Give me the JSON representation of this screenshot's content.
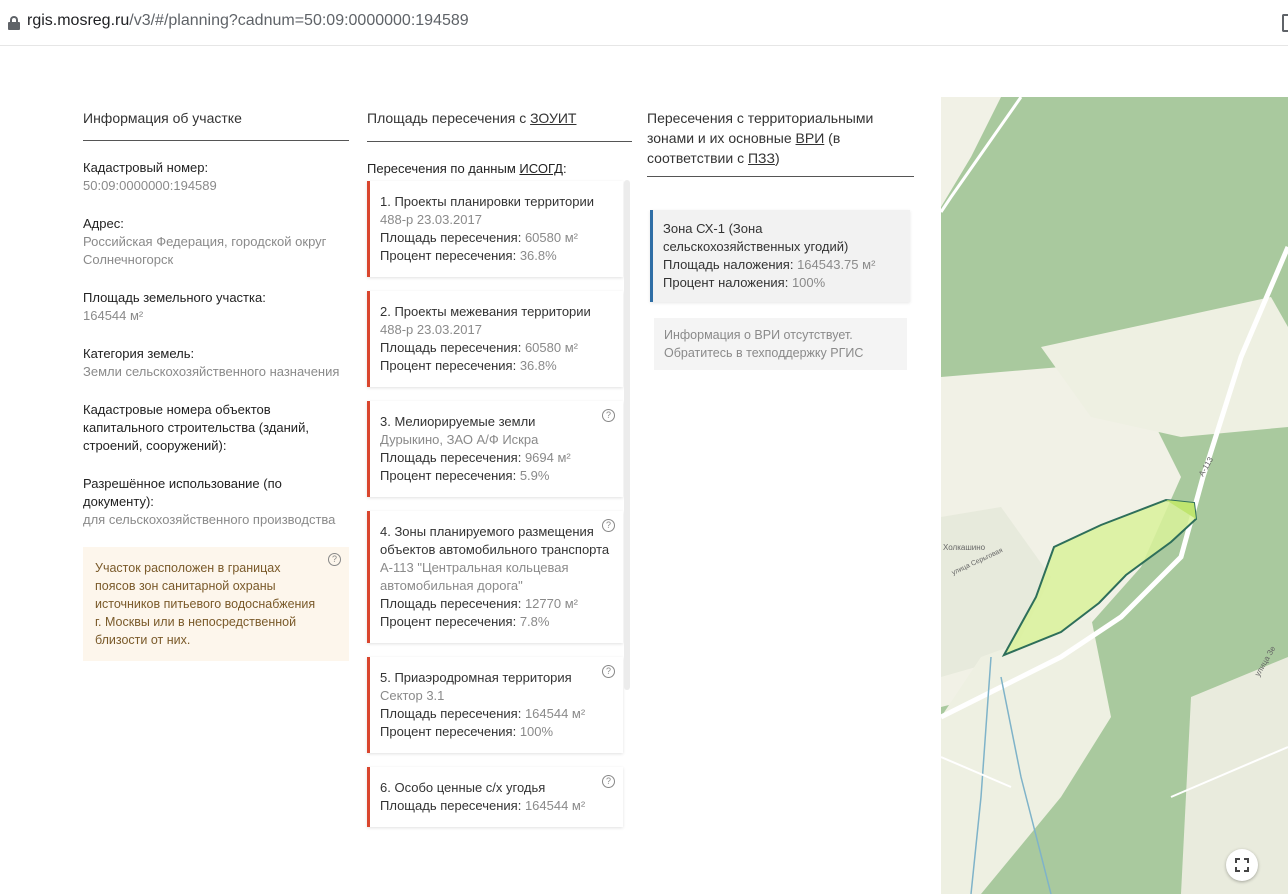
{
  "browser": {
    "url_host": "rgis.mosreg.ru",
    "url_path": "/v3/#/planning?cadnum=50:09:0000000:194589"
  },
  "parcel": {
    "title": "Информация об участке",
    "fields": [
      {
        "label": "Кадастровый номер:",
        "value": "50:09:0000000:194589"
      },
      {
        "label": "Адрес:",
        "value": "Российская Федерация, городской округ Солнечногорск"
      },
      {
        "label": "Площадь земельного участка:",
        "value": "164544 м²"
      },
      {
        "label": "Категория земель:",
        "value": "Земли сельскохозяйственного назначения"
      },
      {
        "label": "Кадастровые номера объектов капитального строительства (зданий, строений, сооружений):",
        "value": ""
      },
      {
        "label": "Разрешённое использование (по документу):",
        "value": "для сельскохозяйственного производства"
      }
    ],
    "notice": "Участок расположен в границах поясов зон санитарной охраны источников питьевого водоснабжения г. Москвы или в непосредственной близости от них.",
    "notice_icon": "question-circle-icon"
  },
  "zouit": {
    "title_prefix": "Площадь пересечения с ",
    "title_link": "ЗОУИТ",
    "subtitle_prefix": "Пересечения по данным ",
    "subtitle_link": "ИСОГД",
    "subtitle_suffix": ":",
    "area_label": "Площадь пересечения: ",
    "percent_label": "Процент пересечения: ",
    "cards": [
      {
        "title": "1. Проекты планировки территории",
        "sub": "488-р 23.03.2017",
        "area": "60580 м²",
        "percent": "36.8%",
        "help": false
      },
      {
        "title": "2. Проекты межевания территории",
        "sub": "488-р 23.03.2017",
        "area": "60580 м²",
        "percent": "36.8%",
        "help": false
      },
      {
        "title": "3. Мелиорируемые земли",
        "sub": "Дурыкино, ЗАО А/Ф Искра",
        "area": "9694 м²",
        "percent": "5.9%",
        "help": true
      },
      {
        "title": "4. Зоны планируемого размещения объектов автомобильного транспорта",
        "sub": "А-113 \"Центральная кольцевая автомобильная дорога\"",
        "area": "12770 м²",
        "percent": "7.8%",
        "help": true
      },
      {
        "title": "5. Приаэродромная территория",
        "sub": "Сектор 3.1",
        "area": "164544 м²",
        "percent": "100%",
        "help": true
      },
      {
        "title": "6. Особо ценные с/х угодья",
        "sub": "",
        "area": "164544 м²",
        "percent": "",
        "help": true
      }
    ]
  },
  "zones": {
    "title_prefix": "Пересечения с территориальными зонами и их основные ",
    "title_link1": "ВРИ",
    "title_mid": " (в соответствии с ",
    "title_link2": "ПЗЗ",
    "title_suffix": ")",
    "card": {
      "title": "Зона СХ-1 (Зона сельскохозяйственных угодий)",
      "area_label": "Площадь наложения: ",
      "area": "164543.75 м²",
      "percent_label": "Процент наложения: ",
      "percent": "100%"
    },
    "vri_info": "Информация о ВРИ отсутствует. Обратитесь в техподдержку РГИС"
  },
  "map": {
    "labels": {
      "village": "Холкашино",
      "road": "А-113",
      "street": "улица Зе",
      "street2": "улица Серьговая"
    },
    "fullscreen_icon": "fullscreen-icon",
    "colors": {
      "forest": "#a9c99e",
      "field": "#f1f1e6",
      "parcel_fill": "#d9f29a",
      "parcel_stroke": "#2e6f5a",
      "road": "#ffffff"
    }
  }
}
